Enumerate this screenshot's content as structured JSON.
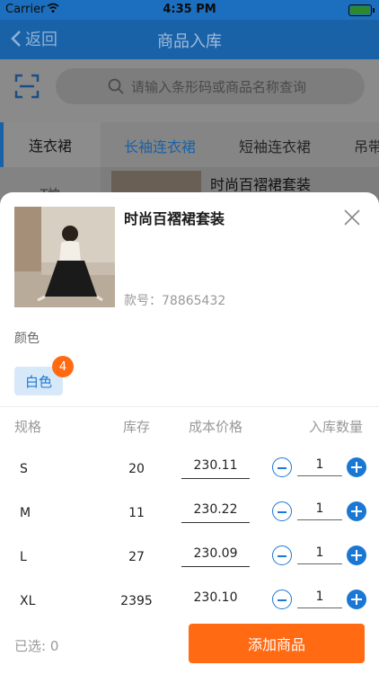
{
  "status_bar": {
    "carrier": "Carrier",
    "time": "4:35 PM"
  },
  "nav": {
    "back_label": "返回",
    "title": "商品入库"
  },
  "search": {
    "placeholder": "请输入条形码或商品名称查询"
  },
  "categories": {
    "selected": "连衣裙",
    "next": "T恤"
  },
  "tabs": [
    "长袖连衣裙",
    "短袖连衣裙",
    "吊带"
  ],
  "background_product_name": "时尚百褶裙套装",
  "sheet": {
    "product_name": "时尚百褶裙套装",
    "sku_label": "款号：",
    "sku_value": "78865432",
    "color_label": "颜色",
    "color_option": "白色",
    "color_badge": "4",
    "headers": {
      "spec": "规格",
      "stock": "库存",
      "price": "成本价格",
      "qty": "入库数量"
    },
    "rows": [
      {
        "spec": "S",
        "stock": "20",
        "price": "230.11",
        "qty": "1"
      },
      {
        "spec": "M",
        "stock": "11",
        "price": "230.22",
        "qty": "1"
      },
      {
        "spec": "L",
        "stock": "27",
        "price": "230.09",
        "qty": "1"
      },
      {
        "spec": "XL",
        "stock": "2395",
        "price": "230.10",
        "qty": "1"
      }
    ],
    "selected_count": "已选: 0",
    "add_button": "添加商品"
  },
  "colors": {
    "nav_blue": "#1a62a8",
    "accent_blue": "#1a78d4",
    "orange": "#ff6a13"
  }
}
